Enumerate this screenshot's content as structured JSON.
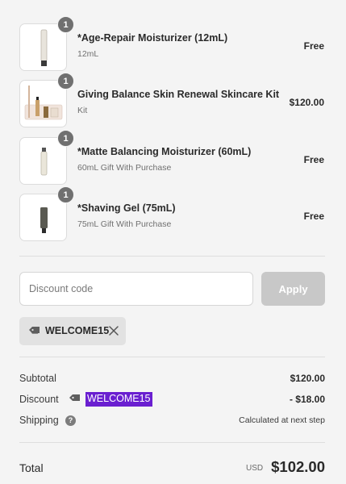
{
  "items": [
    {
      "quantity": "1",
      "name": "*Age-Repair Moisturizer (12mL)",
      "subtitle": "12mL",
      "price": "Free",
      "image_icon": "tube-icon"
    },
    {
      "quantity": "1",
      "name": "Giving Balance Skin Renewal Skincare Kit",
      "subtitle": "Kit",
      "price": "$120.00",
      "image_icon": "kit-icon"
    },
    {
      "quantity": "1",
      "name": "*Matte Balancing Moisturizer (60mL)",
      "subtitle": "60mL Gift With Purchase",
      "price": "Free",
      "image_icon": "tube-icon"
    },
    {
      "quantity": "1",
      "name": "*Shaving Gel (75mL)",
      "subtitle": "75mL Gift With Purchase",
      "price": "Free",
      "image_icon": "tube-icon"
    }
  ],
  "discount": {
    "placeholder": "Discount code",
    "apply_label": "Apply",
    "applied_code": "WELCOME15"
  },
  "summary": {
    "subtotal_label": "Subtotal",
    "subtotal_value": "$120.00",
    "discount_label": "Discount",
    "discount_code": "WELCOME15",
    "discount_value": "- $18.00",
    "shipping_label": "Shipping",
    "shipping_help_icon": "?",
    "shipping_value": "Calculated at next step",
    "total_label": "Total",
    "currency": "USD",
    "total_value": "$102.00"
  },
  "colors": {
    "background": "#f4f4f4",
    "highlight": "#6a1fd0",
    "apply_disabled": "#c8c8c8",
    "badge": "#707070"
  }
}
